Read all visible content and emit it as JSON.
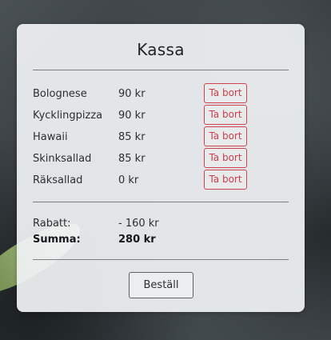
{
  "checkout": {
    "title": "Kassa",
    "items": [
      {
        "name": "Bolognese",
        "price": "90 kr",
        "remove_label": "Ta bort"
      },
      {
        "name": "Kycklingpizza",
        "price": "90 kr",
        "remove_label": "Ta bort"
      },
      {
        "name": "Hawaii",
        "price": "85 kr",
        "remove_label": "Ta bort"
      },
      {
        "name": "Skinksallad",
        "price": "85 kr",
        "remove_label": "Ta bort"
      },
      {
        "name": "Räksallad",
        "price": "0 kr",
        "remove_label": "Ta bort"
      }
    ],
    "discount_label": "Rabatt:",
    "discount_value": "- 160 kr",
    "total_label": "Summa:",
    "total_value": "280 kr",
    "order_button_label": "Beställ"
  },
  "colors": {
    "remove_button": "#cc3d4a",
    "card_background": "#f0f2f4"
  }
}
